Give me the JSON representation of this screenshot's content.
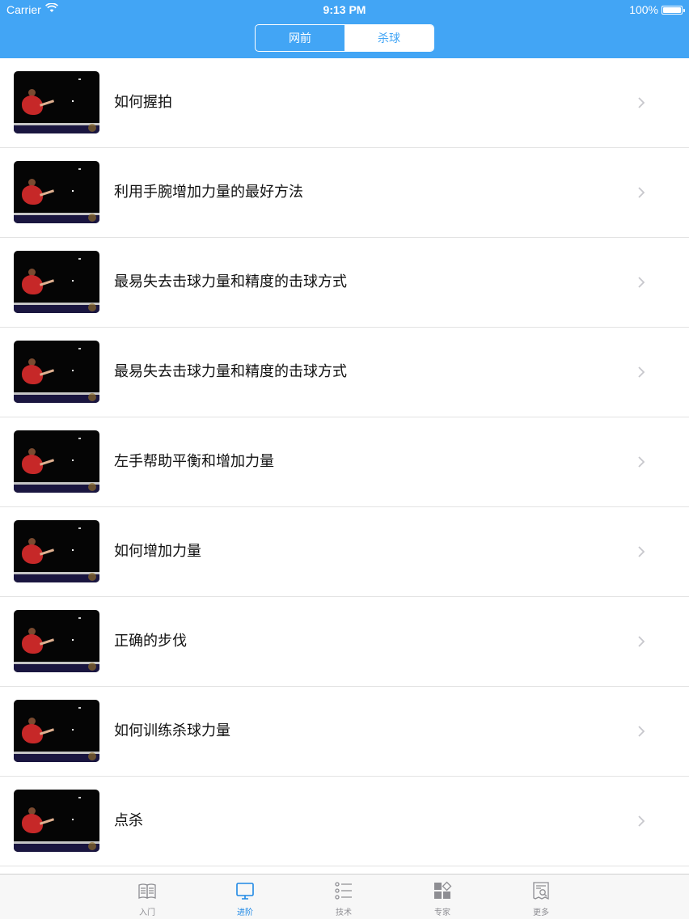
{
  "status_bar": {
    "carrier": "Carrier",
    "time": "9:13 PM",
    "battery": "100%"
  },
  "segmented": {
    "options": [
      "网前",
      "杀球"
    ],
    "selected": "杀球"
  },
  "list": [
    {
      "title": "如何握拍"
    },
    {
      "title": "利用手腕增加力量的最好方法"
    },
    {
      "title": "最易失去击球力量和精度的击球方式"
    },
    {
      "title": "最易失去击球力量和精度的击球方式"
    },
    {
      "title": "左手帮助平衡和增加力量"
    },
    {
      "title": "如何增加力量"
    },
    {
      "title": "正确的步伐"
    },
    {
      "title": "如何训练杀球力量"
    },
    {
      "title": "点杀"
    }
  ],
  "tabbar": {
    "items": [
      {
        "label": "入门",
        "icon": "book-icon"
      },
      {
        "label": "进阶",
        "icon": "monitor-icon"
      },
      {
        "label": "技术",
        "icon": "list-icon"
      },
      {
        "label": "专家",
        "icon": "grid-icon"
      },
      {
        "label": "更多",
        "icon": "document-icon"
      }
    ],
    "selected": "进阶"
  },
  "colors": {
    "accent": "#42a5f5",
    "tab_active": "#1e88e5",
    "tab_inactive": "#8e8e93"
  }
}
